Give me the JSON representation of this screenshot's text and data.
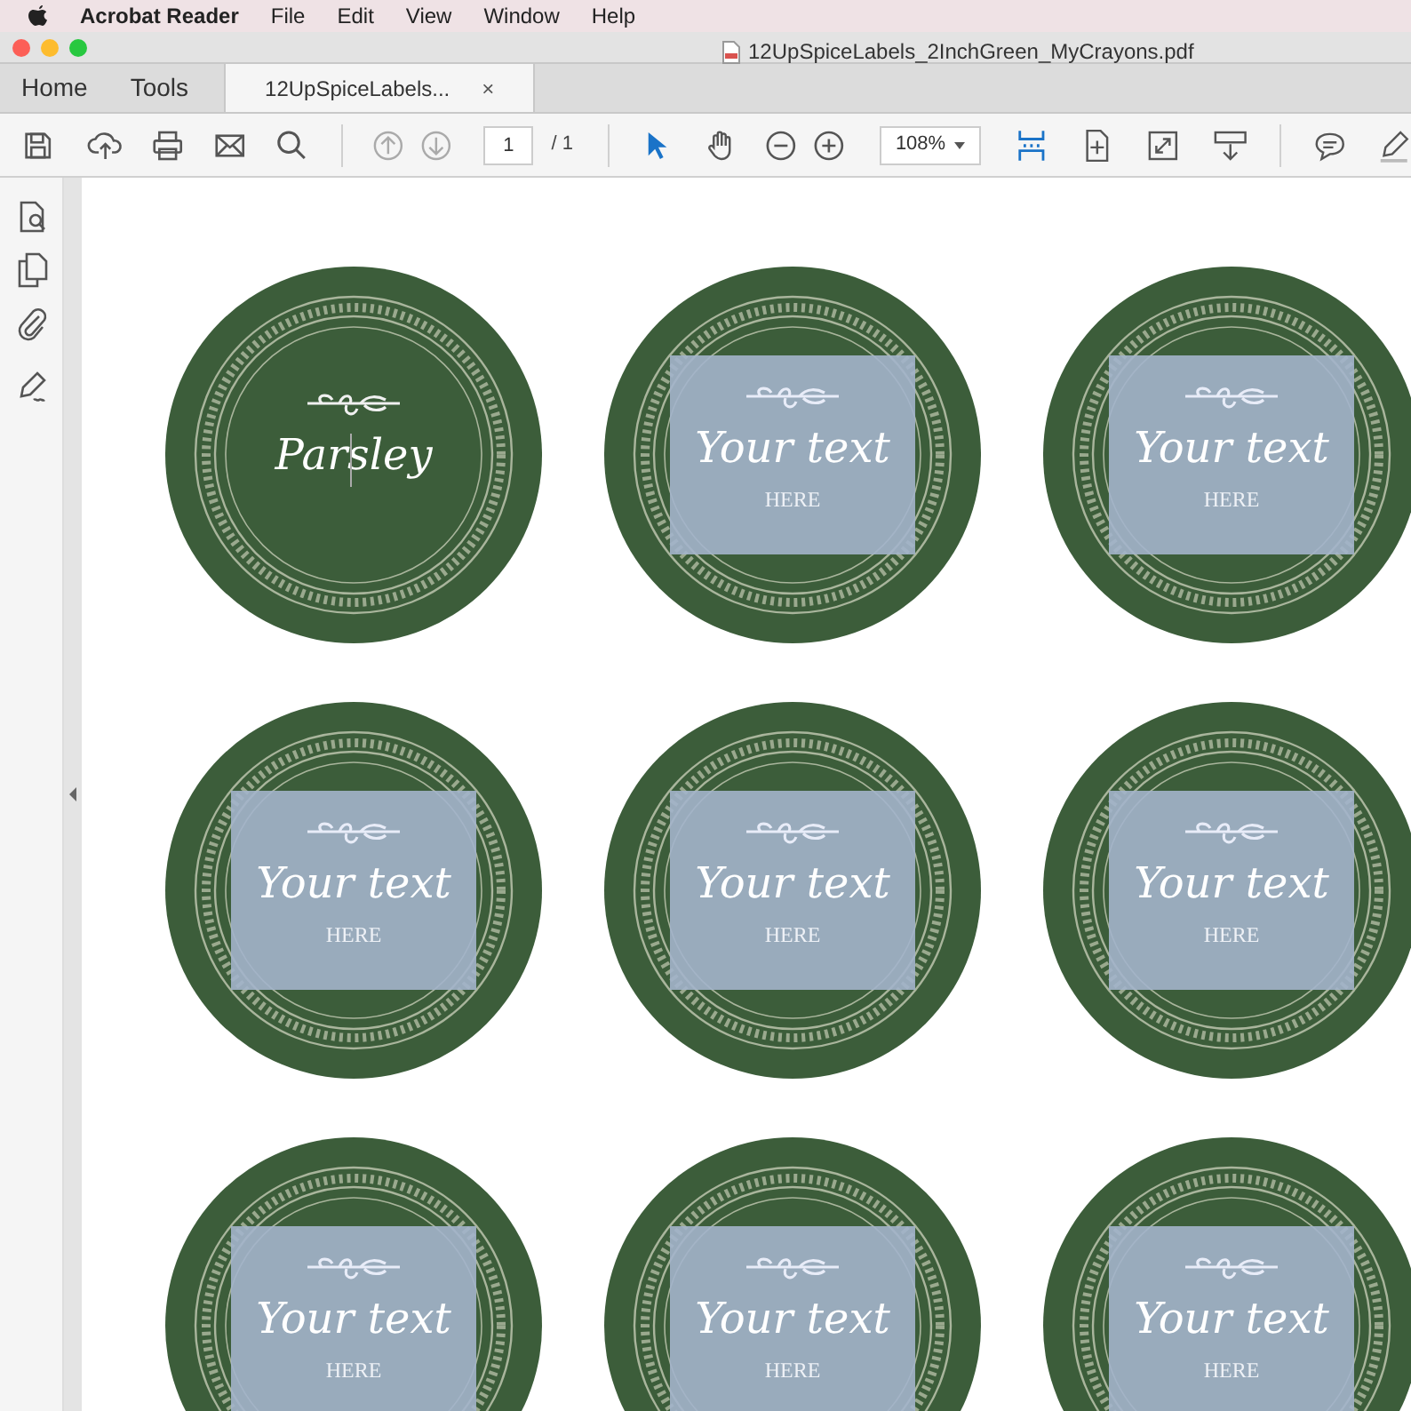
{
  "menu_bar": {
    "app": "Acrobat Reader",
    "items": [
      "File",
      "Edit",
      "View",
      "Window",
      "Help"
    ]
  },
  "window": {
    "title": "12UpSpiceLabels_2InchGreen_MyCrayons.pdf"
  },
  "tabs": [
    {
      "label": "Home",
      "selected": false
    },
    {
      "label": "Tools",
      "selected": false
    },
    {
      "label": "12UpSpiceLabels...",
      "selected": true,
      "closable": true,
      "close": "×"
    }
  ],
  "toolbar": {
    "page": "1",
    "page_total": "/ 1",
    "zoom": "108%"
  },
  "labels": [
    {
      "kind": "text",
      "title": "Parsley",
      "editing": true
    },
    {
      "kind": "field",
      "title": "Your text",
      "subtitle": "HERE",
      "editing": false
    },
    {
      "kind": "field",
      "title": "Your text",
      "subtitle": "HERE",
      "editing": false
    },
    {
      "kind": "field",
      "title": "Your text",
      "subtitle": "HERE",
      "editing": false
    },
    {
      "kind": "field",
      "title": "Your text",
      "subtitle": "HERE",
      "editing": false
    },
    {
      "kind": "field",
      "title": "Your text",
      "subtitle": "HERE",
      "editing": false
    },
    {
      "kind": "field",
      "title": "Your text",
      "subtitle": "HERE",
      "editing": false
    },
    {
      "kind": "field",
      "title": "Your text",
      "subtitle": "HERE",
      "editing": false
    },
    {
      "kind": "field",
      "title": "Your text",
      "subtitle": "HERE",
      "editing": false
    }
  ]
}
